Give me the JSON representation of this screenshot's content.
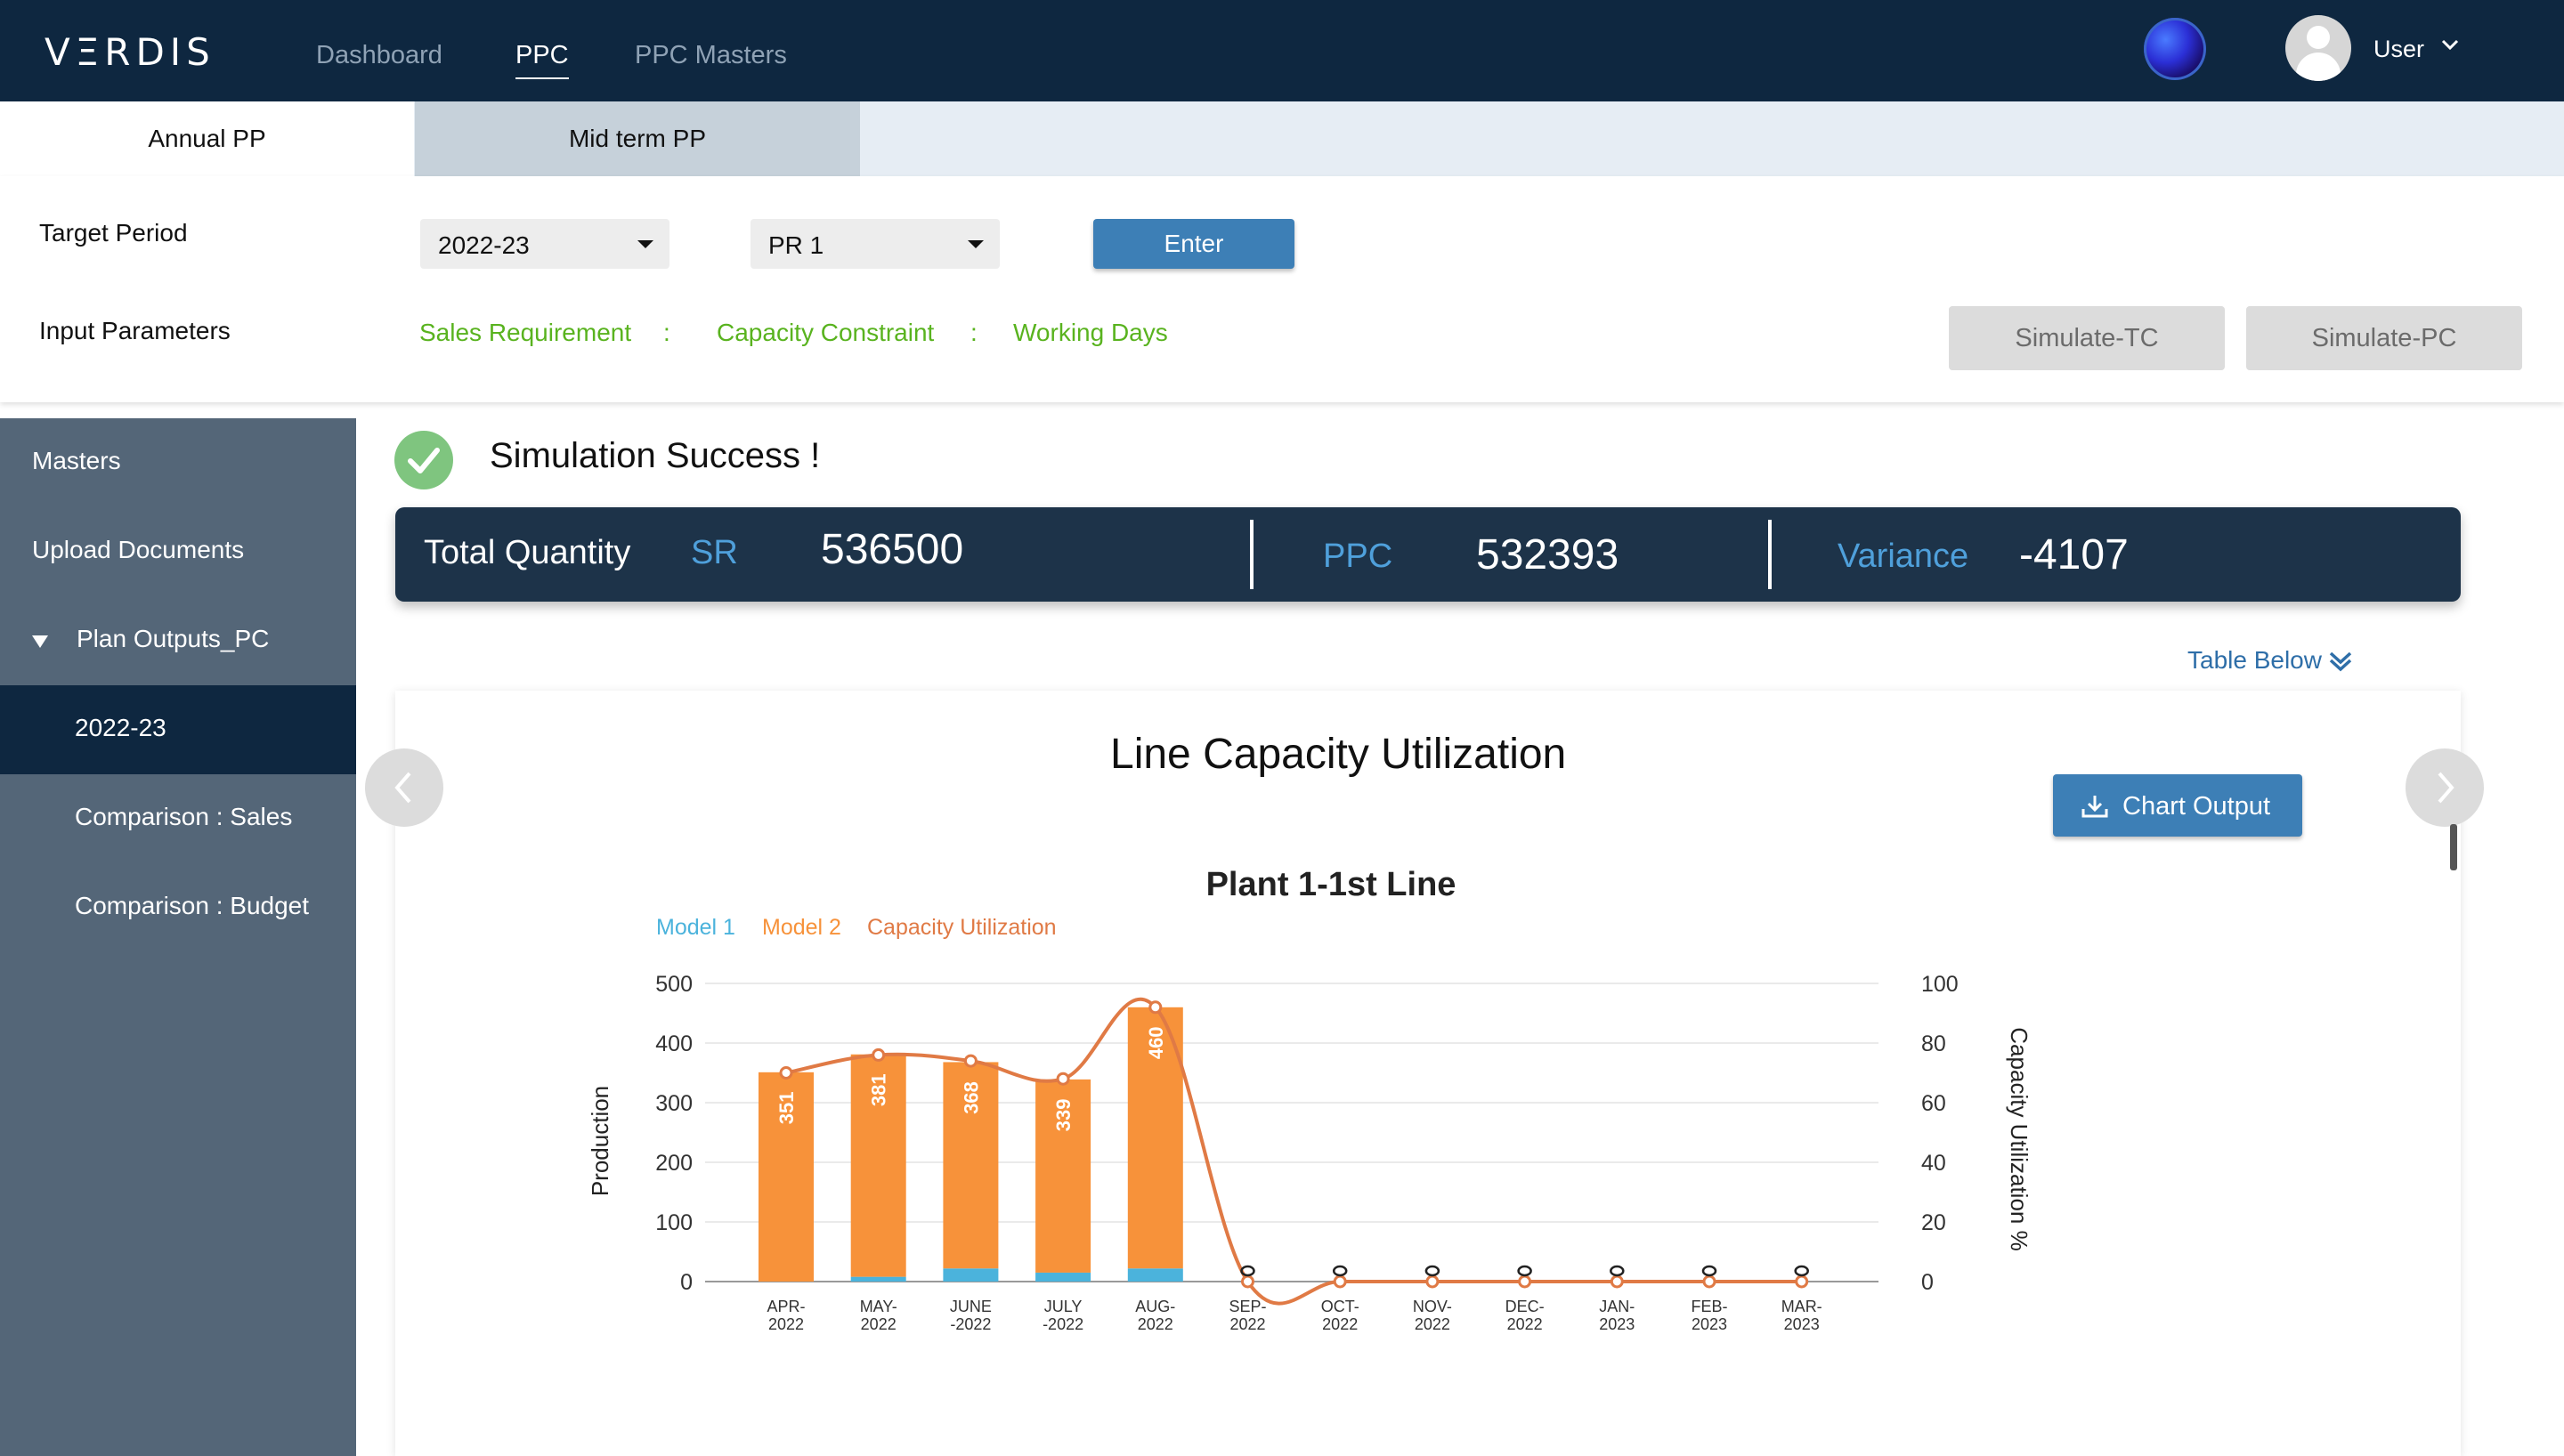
{
  "app": {
    "logo": "VΞRDIS",
    "nav": [
      "Dashboard",
      "PPC",
      "PPC Masters"
    ],
    "user_label": "User"
  },
  "tabs": [
    "Annual PP",
    "Mid term PP"
  ],
  "params": {
    "target_period_label": "Target Period",
    "period_value": "2022-23",
    "plan_value": "PR 1",
    "enter_label": "Enter",
    "input_params_label": "Input Parameters",
    "input_links": [
      "Sales Requirement",
      "Capacity Constraint",
      "Working Days"
    ],
    "separator": ":",
    "simulate_tc": "Simulate-TC",
    "simulate_pc": "Simulate-PC"
  },
  "sidebar": {
    "items": [
      "Masters",
      "Upload Documents",
      "Plan Outputs_PC",
      "2022-23",
      "Comparison : Sales",
      "Comparison : Budget"
    ]
  },
  "main": {
    "success_text": "Simulation Success !",
    "total_quantity_label": "Total Quantity",
    "sr_label": "SR",
    "sr_value": "536500",
    "ppc_label": "PPC",
    "ppc_value": "532393",
    "variance_label": "Variance",
    "variance_value": "-4107",
    "table_below": "Table Below",
    "card_title": "Line Capacity Utilization",
    "chart_output_label": "Chart Output"
  },
  "colors": {
    "nav_bg": "#0e2740",
    "accent_blue": "#3d7fb6",
    "green": "#59b31f",
    "model1": "#4bb3dc",
    "model2": "#f7923a",
    "capacity": "#e07a45"
  },
  "chart_data": {
    "type": "bar",
    "title": "Plant 1-1st Line",
    "categories": [
      "APR-2022",
      "MAY-2022",
      "JUNE-2022",
      "JULY-2022",
      "AUG-2022",
      "SEP-2022",
      "OCT-2022",
      "NOV-2022",
      "DEC-2022",
      "JAN-2023",
      "FEB-2023",
      "MAR-2023"
    ],
    "category_labels": [
      [
        "APR-",
        "2022"
      ],
      [
        "MAY-",
        "2022"
      ],
      [
        "JUNE",
        "-2022"
      ],
      [
        "JULY",
        "-2022"
      ],
      [
        "AUG-",
        "2022"
      ],
      [
        "SEP-",
        "2022"
      ],
      [
        "OCT-",
        "2022"
      ],
      [
        "NOV-",
        "2022"
      ],
      [
        "DEC-",
        "2022"
      ],
      [
        "JAN-",
        "2023"
      ],
      [
        "FEB-",
        "2023"
      ],
      [
        "MAR-",
        "2023"
      ]
    ],
    "series": [
      {
        "name": "Model 1",
        "type": "bar",
        "stack": "production",
        "color": "#4bb3dc",
        "values": [
          0,
          8,
          22,
          15,
          22,
          0,
          0,
          0,
          0,
          0,
          0,
          0
        ]
      },
      {
        "name": "Model 2",
        "type": "bar",
        "stack": "production",
        "color": "#f7923a",
        "values": [
          351,
          373,
          346,
          324,
          438,
          0,
          0,
          0,
          0,
          0,
          0,
          0
        ]
      },
      {
        "name": "Capacity Utilization",
        "type": "line",
        "axis": "right",
        "color": "#e07a45",
        "values": [
          70,
          76,
          74,
          68,
          92,
          0,
          0,
          0,
          0,
          0,
          0,
          0
        ]
      }
    ],
    "bar_labels": [
      "351",
      "381",
      "368",
      "339",
      "460",
      "",
      "",
      "",
      "",
      "",
      "",
      ""
    ],
    "ylabel": "Production",
    "y2label": "Capacity Utilization %",
    "ylim": [
      0,
      500
    ],
    "y2lim": [
      0,
      100
    ],
    "yticks": [
      0,
      100,
      200,
      300,
      400,
      500
    ],
    "y2ticks": [
      0,
      20,
      40,
      60,
      80,
      100
    ],
    "grid": true,
    "legend": "top-left"
  }
}
